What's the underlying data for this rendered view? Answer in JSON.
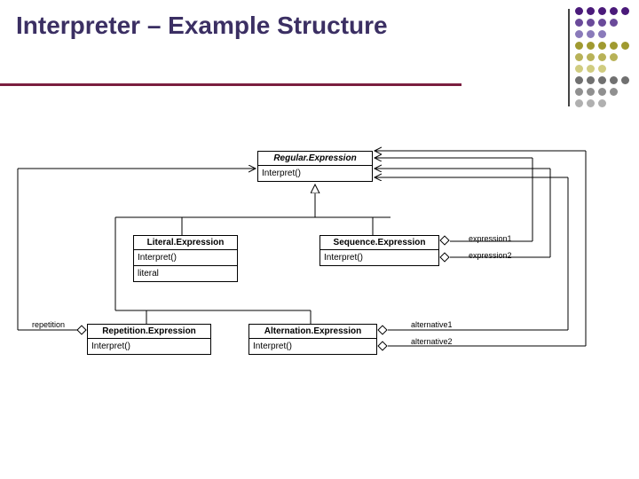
{
  "slide": {
    "title": "Interpreter – Example Structure"
  },
  "decoration": {
    "dot_colors": [
      "#4a1a7a",
      "#6a4a9a",
      "#8a7aba",
      "#a09a30",
      "#b8b258",
      "#d0cc80",
      "#707070",
      "#909090",
      "#b0b0b0"
    ]
  },
  "classes": {
    "regular": {
      "name": "Regular.Expression",
      "method": "Interpret()"
    },
    "literal": {
      "name": "Literal.Expression",
      "method": "Interpret()",
      "attr": "literal"
    },
    "sequence": {
      "name": "Sequence.Expression",
      "method": "Interpret()"
    },
    "repetition": {
      "name": "Repetition.Expression",
      "method": "Interpret()"
    },
    "alternation": {
      "name": "Alternation.Expression",
      "method": "Interpret()"
    }
  },
  "roles": {
    "repetition": "repetition",
    "expr1": "expression1",
    "expr2": "expression2",
    "alt1": "alternative1",
    "alt2": "alternative2"
  }
}
